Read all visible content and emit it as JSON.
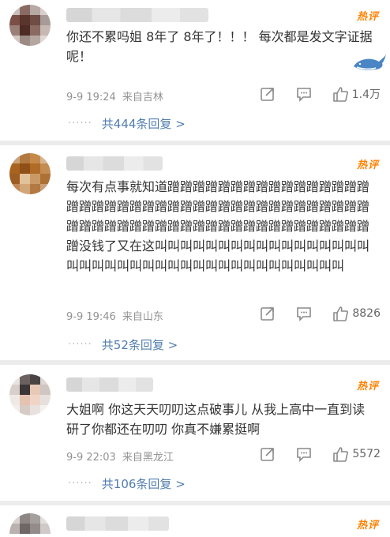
{
  "comments": [
    {
      "hot_label": "热评",
      "text": "你还不累吗姐 8年了 8年了！！！ 每次都是发文字证据呢！",
      "time": "9-9 19:24",
      "source": "来自吉林",
      "likes": "1.4万",
      "replies": "共444条回复 >"
    },
    {
      "hot_label": "热评",
      "text": "每次有点事就知道蹭蹭蹭蹭蹭蹭蹭蹭蹭蹭蹭蹭蹭蹭蹭蹭蹭蹭蹭蹭蹭蹭蹭蹭蹭蹭蹭蹭蹭蹭蹭蹭蹭蹭蹭蹭蹭蹭蹭蹭蹭蹭蹭蹭蹭蹭蹭蹭蹭蹭蹭蹭蹭蹭蹭蹭蹭蹭蹭蹭蹭蹭蹭蹭蹭没钱了又在这叫叫叫叫叫叫叫叫叫叫叫叫叫叫叫叫叫叫叫叫叫叫叫叫叫叫叫叫叫叫叫叫叫叫叫叫叫叫叫",
      "time": "9-9 19:46",
      "source": "来自山东",
      "likes": "8826",
      "replies": "共52条回复 >"
    },
    {
      "hot_label": "热评",
      "text": "大姐啊 你这天天叨叨这点破事儿 从我上高中一直到读研了你都还在叨叨 你真不嫌累挺啊",
      "time": "9-9 22:03",
      "source": "来自黑龙江",
      "likes": "5572",
      "replies": "共106条回复 >"
    },
    {
      "hot_label": "热评"
    }
  ],
  "icons": {
    "forward": "share-icon",
    "comment": "comment-icon",
    "like": "thumbs-up-icon"
  },
  "colors": {
    "hot": "#ff8200",
    "reply_link": "#507daf",
    "meta": "#939393"
  }
}
